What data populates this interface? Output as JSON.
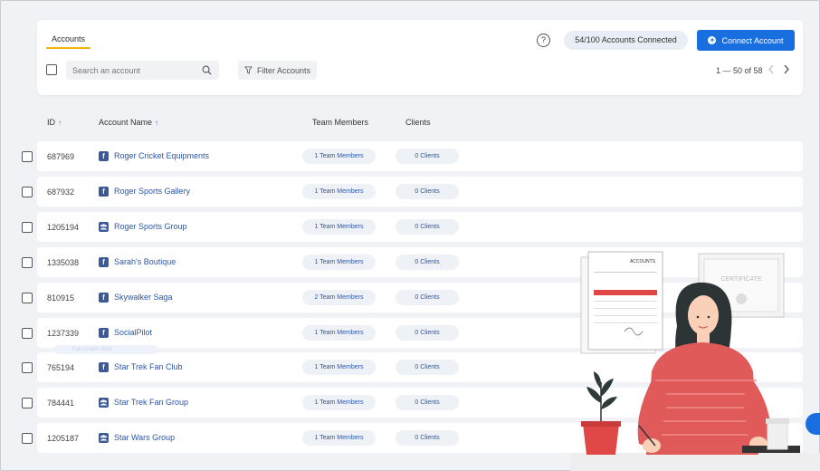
{
  "tabs": [
    {
      "label": "Accounts",
      "active": true
    }
  ],
  "help": {
    "label": "?"
  },
  "connection": {
    "status_text": "54/100  Accounts Connected"
  },
  "connect_button": {
    "label": "Connect Account",
    "icon": "plus-circle-icon"
  },
  "search": {
    "placeholder": "Search an account"
  },
  "filter_button": {
    "label": "Filter Accounts",
    "icon": "filter-icon"
  },
  "pagination": {
    "text": "1 — 50 of 58"
  },
  "columns": {
    "id": "ID",
    "account_name": "Account Name",
    "team_members": "Team Members",
    "clients": "Clients",
    "sort_arrow": "↑"
  },
  "tooltip_ghost": "Full-screen Shot",
  "accent_color": "#1a6fe0",
  "rows": [
    {
      "id": "687969",
      "icon": "facebook-page-icon",
      "glyph": "f",
      "name": "Roger Cricket Equipments",
      "team": "1 Team Members",
      "clients": "0 Clients"
    },
    {
      "id": "687932",
      "icon": "facebook-page-icon",
      "glyph": "f",
      "name": "Roger Sports Gallery",
      "team": "1 Team Members",
      "clients": "0 Clients"
    },
    {
      "id": "1205194",
      "icon": "facebook-group-icon",
      "glyph": "",
      "name": "Roger Sports Group",
      "team": "1 Team Members",
      "clients": "0 Clients"
    },
    {
      "id": "1335038",
      "icon": "facebook-page-icon",
      "glyph": "f",
      "name": "Sarah's Boutique",
      "team": "1 Team Members",
      "clients": "0 Clients"
    },
    {
      "id": "810915",
      "icon": "facebook-page-icon",
      "glyph": "f",
      "name": "Skywalker Saga",
      "team": "2 Team Members",
      "clients": "0 Clients"
    },
    {
      "id": "1237339",
      "icon": "facebook-page-icon",
      "glyph": "f",
      "name": "SocialPilot",
      "team": "1 Team Members",
      "clients": "0 Clients"
    },
    {
      "id": "765194",
      "icon": "facebook-page-icon",
      "glyph": "f",
      "name": "Star Trek Fan Club",
      "team": "1 Team Members",
      "clients": "0 Clients"
    },
    {
      "id": "784441",
      "icon": "facebook-group-icon",
      "glyph": "",
      "name": "Star Trek Fan Group",
      "team": "1 Team Members",
      "clients": "0 Clients"
    },
    {
      "id": "1205187",
      "icon": "facebook-group-icon",
      "glyph": "",
      "name": "Star Wars Group",
      "team": "1 Team Members",
      "clients": "0 Clients"
    }
  ],
  "illustration": {
    "doc_title": "ACCOUNTS",
    "certificate_title": "CERTIFICATE"
  }
}
